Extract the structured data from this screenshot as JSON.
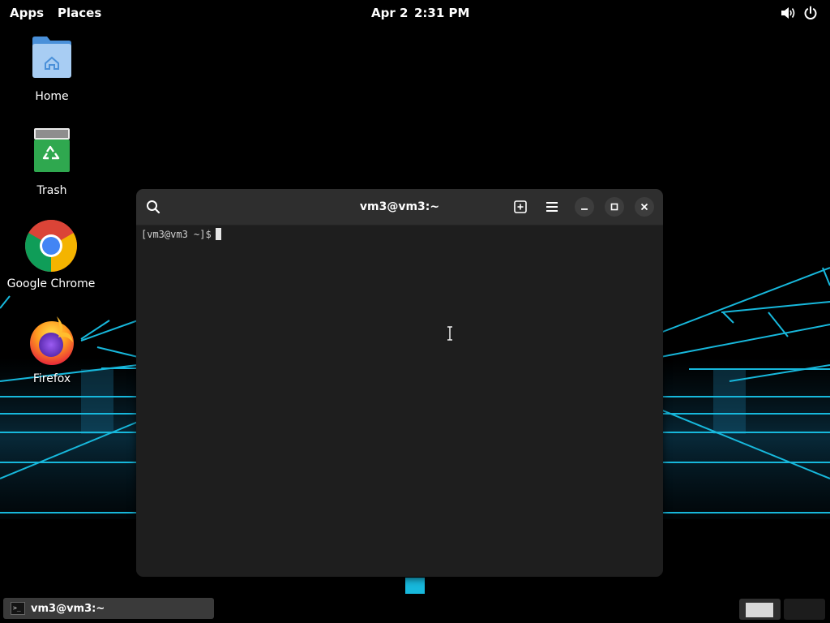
{
  "topbar": {
    "apps_label": "Apps",
    "places_label": "Places",
    "date": "Apr 2",
    "time": "2:31 PM",
    "volume_icon": "volume-icon",
    "power_icon": "power-icon"
  },
  "desktop": {
    "icons": [
      {
        "label": "Home",
        "icon": "home-folder-icon"
      },
      {
        "label": "Trash",
        "icon": "trash-icon"
      },
      {
        "label": "Google Chrome",
        "icon": "chrome-icon"
      },
      {
        "label": "Firefox",
        "icon": "firefox-icon"
      }
    ],
    "wallpaper_accent": "#16b7d6"
  },
  "terminal": {
    "title": "vm3@vm3:~",
    "prompt": "[vm3@vm3 ~]$",
    "header_icons": [
      "search-icon",
      "new-tab-icon",
      "hamburger-menu-icon",
      "minimize-icon",
      "maximize-icon",
      "close-icon"
    ],
    "background": "#1e1e1e",
    "header_background": "#2e2e2e"
  },
  "taskbar": {
    "window_label": "vm3@vm3:~",
    "window_icon": "terminal-icon",
    "workspaces": [
      "workspace-1",
      "workspace-2"
    ]
  }
}
